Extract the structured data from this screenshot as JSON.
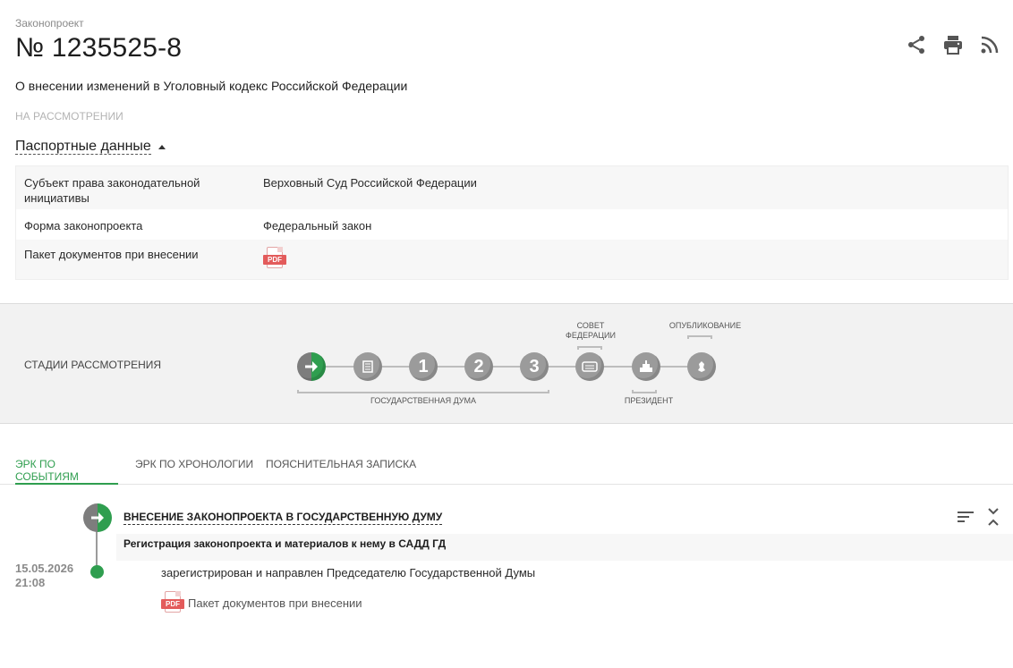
{
  "bill": {
    "label": "Законопроект",
    "number": "№ 1235525-8",
    "title": "О внесении изменений в Уголовный кодекс Российской Федерации",
    "status": "НА РАССМОТРЕНИИ"
  },
  "actions": [
    {
      "name": "share",
      "icon": "share-icon"
    },
    {
      "name": "print",
      "icon": "print-icon"
    },
    {
      "name": "rss",
      "icon": "rss-icon"
    }
  ],
  "passport": {
    "toggle_label": "Паспортные данные",
    "rows": [
      {
        "key": "Субъект права законодательной инициативы",
        "value": "Верховный Суд Российской Федерации"
      },
      {
        "key": "Форма законопроекта",
        "value": "Федеральный закон"
      },
      {
        "key": "Пакет документов при внесении",
        "value": "PDF"
      }
    ]
  },
  "stages": {
    "title": "СТАДИИ РАССМОТРЕНИЯ",
    "items": [
      {
        "id": "submission",
        "glyph": "",
        "state": "active"
      },
      {
        "id": "preliminary",
        "glyph": "",
        "state": "pending"
      },
      {
        "id": "reading-1",
        "glyph": "1",
        "state": "pending"
      },
      {
        "id": "reading-2",
        "glyph": "2",
        "state": "pending"
      },
      {
        "id": "reading-3",
        "glyph": "3",
        "state": "pending"
      },
      {
        "id": "federation-council",
        "glyph": "",
        "state": "pending"
      },
      {
        "id": "president",
        "glyph": "",
        "state": "pending"
      },
      {
        "id": "publication",
        "glyph": "",
        "state": "pending"
      }
    ],
    "labels": {
      "duma": "ГОСУДАРСТВЕННАЯ ДУМА",
      "council": "СОВЕТ ФЕДЕРАЦИИ",
      "president": "ПРЕЗИДЕНТ",
      "publication": "ОПУБЛИКОВАНИЕ"
    }
  },
  "tabs": [
    {
      "label": "ЭРК ПО СОБЫТИЯМ",
      "active": true
    },
    {
      "label": "ЭРК ПО ХРОНОЛОГИИ",
      "active": false
    },
    {
      "label": "ПОЯСНИТЕЛЬНАЯ ЗАПИСКА",
      "active": false
    }
  ],
  "event": {
    "title": "ВНЕСЕНИЕ ЗАКОНОПРОЕКТА В ГОСУДАРСТВЕННУЮ ДУМУ",
    "subtitle": "Регистрация законопроекта и материалов к нему в САДД ГД",
    "date": "15.05.2026",
    "time": "21:08",
    "text": "зарегистрирован и направлен Председателю Государственной Думы",
    "doc_label": "Пакет документов при внесении",
    "doc_badge": "PDF"
  },
  "colors": {
    "accent": "#2f9e4f",
    "stage_gray": "#9b9b9b",
    "pdf_red": "#e35b5b"
  }
}
